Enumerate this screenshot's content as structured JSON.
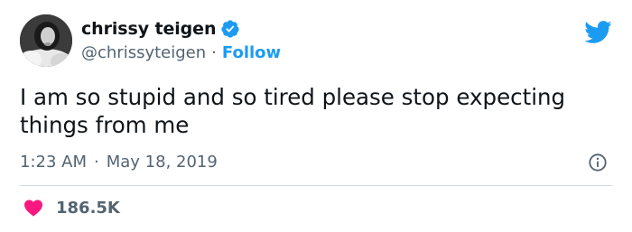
{
  "author": {
    "display_name": "chrissy teigen",
    "handle": "@chrissyteigen",
    "separator": "·",
    "follow_label": "Follow",
    "verified": true
  },
  "tweet": {
    "text": "I am so stupid and so tired please stop expecting things from me",
    "time": "1:23 AM",
    "date_separator": "·",
    "date": "May 18, 2019"
  },
  "engagement": {
    "likes": "186.5K"
  },
  "icons": {
    "verified": "verified-badge-icon",
    "bird": "twitter-bird-icon",
    "info": "info-icon",
    "heart": "heart-icon"
  },
  "colors": {
    "accent": "#1d9bf0",
    "heart": "#f91880",
    "secondary_text": "#536471",
    "primary_text": "#0f1419",
    "divider": "#cfd9de"
  }
}
